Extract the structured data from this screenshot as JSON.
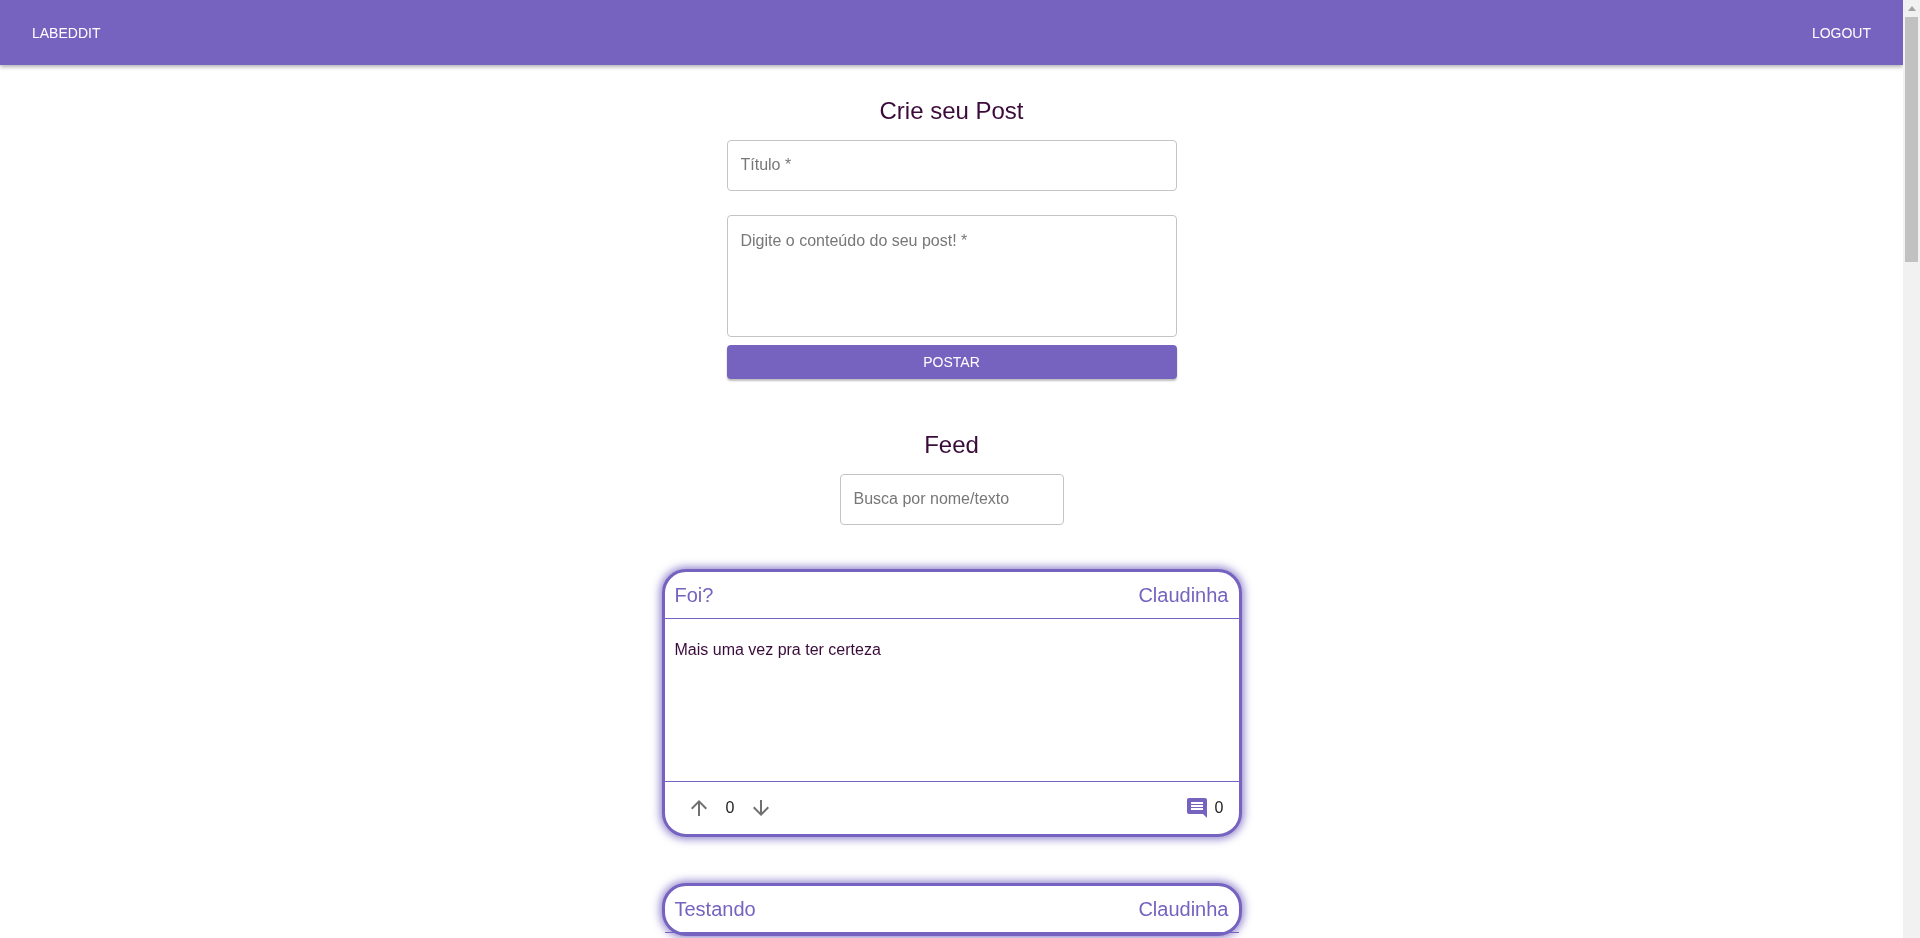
{
  "app_bar": {
    "brand": "LABEDDIT",
    "action": "LOGOUT"
  },
  "create_post": {
    "heading": "Crie seu Post",
    "title_field": {
      "placeholder": "Título *"
    },
    "content_field": {
      "placeholder": "Digite o conteúdo do seu post! *"
    },
    "submit": "POSTAR"
  },
  "feed": {
    "heading": "Feed",
    "search": {
      "placeholder": "Busca por nome/texto"
    },
    "posts": [
      {
        "title": "Foi?",
        "author": "Claudinha",
        "body": "Mais uma vez pra ter certeza",
        "votes": "0",
        "comments": "0"
      },
      {
        "title": "Testando",
        "author": "Claudinha"
      }
    ]
  }
}
